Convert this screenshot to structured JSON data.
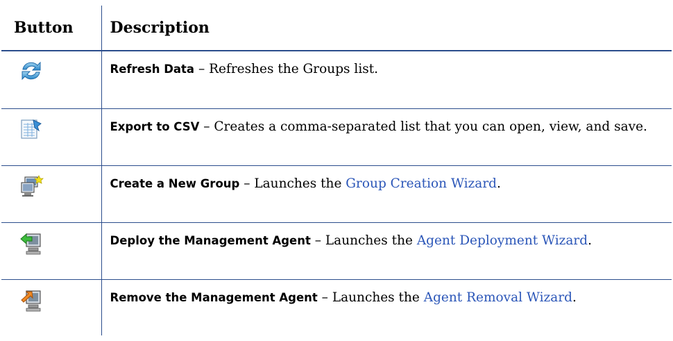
{
  "table": {
    "headers": {
      "button": "Button",
      "description": "Description"
    },
    "rows": [
      {
        "icon": "refresh-icon",
        "term": "Refresh Data",
        "sep": " – ",
        "text": "Refreshes the Groups list.",
        "link": "",
        "tail": ""
      },
      {
        "icon": "export-csv-icon",
        "term": "Export to CSV",
        "sep": " – ",
        "text": "Creates a comma-separated list that you can open, view, and save.",
        "link": "",
        "tail": ""
      },
      {
        "icon": "create-group-icon",
        "term": "Create a New Group",
        "sep": " – ",
        "text": "Launches the ",
        "link": "Group Creation Wizard",
        "tail": "."
      },
      {
        "icon": "deploy-agent-icon",
        "term": "Deploy the Management Agent",
        "sep": " – ",
        "text": "Launches the ",
        "link": "Agent Deployment Wizard",
        "tail": "."
      },
      {
        "icon": "remove-agent-icon",
        "term": "Remove the Management Agent",
        "sep": " – ",
        "text": "Launches the ",
        "link": "Agent Removal Wizard",
        "tail": "."
      }
    ]
  },
  "colors": {
    "rule": "#2b4d8c",
    "link": "#2b56b8"
  }
}
